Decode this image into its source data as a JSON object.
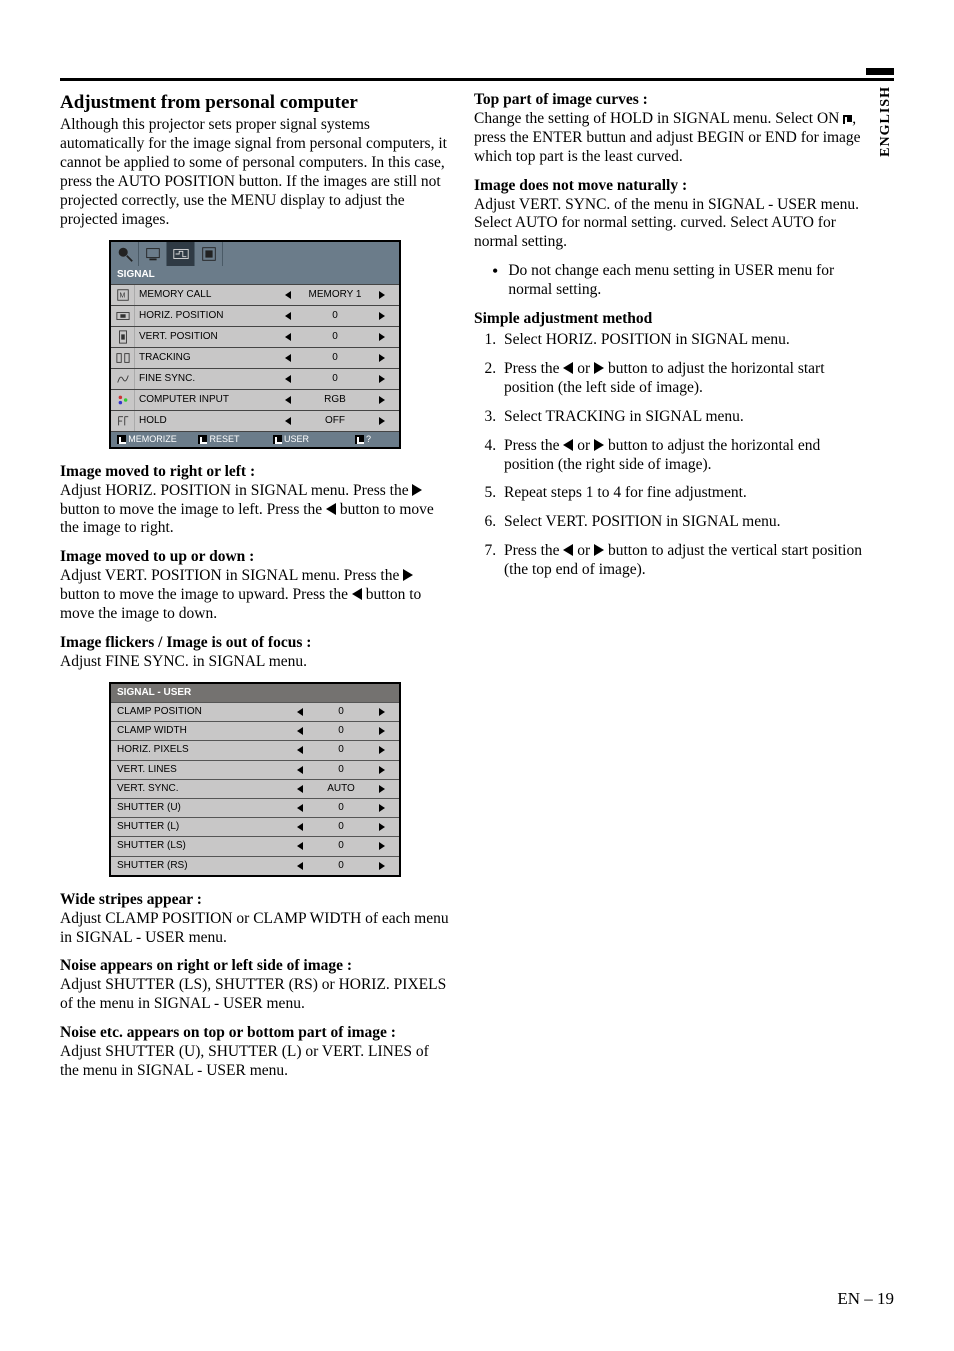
{
  "lang_label": "ENGLISH",
  "left": {
    "heading": "Adjustment from personal computer",
    "intro": "Although this projector sets proper signal systems automatically for the image signal from personal computers, it cannot be applied to some of personal computers.  In this case, press the AUTO POSITION button.  If the images are still not projected correctly, use the MENU display to adjust the projected images.",
    "signal_menu": {
      "title": "SIGNAL",
      "rows": [
        {
          "label": "MEMORY CALL",
          "value": "MEMORY 1"
        },
        {
          "label": "HORIZ. POSITION",
          "value": "0"
        },
        {
          "label": "VERT. POSITION",
          "value": "0"
        },
        {
          "label": "TRACKING",
          "value": "0"
        },
        {
          "label": "FINE SYNC.",
          "value": "0"
        },
        {
          "label": "COMPUTER INPUT",
          "value": "RGB"
        },
        {
          "label": "HOLD",
          "value": "OFF"
        }
      ],
      "footer": [
        "MEMORIZE",
        "RESET",
        "USER",
        "?"
      ]
    },
    "p1_title": "Image moved to right or left :",
    "p1_body_a": "Adjust HORIZ. POSITION in SIGNAL menu.  Press the ",
    "p1_body_b": " button to move the image to left.  Press the ",
    "p1_body_c": " button to move the image to right.",
    "p2_title": "Image moved to up or down :",
    "p2_body_a": "Adjust VERT. POSITION in SIGNAL menu.  Press the ",
    "p2_body_b": " button to move the image to upward.  Press the ",
    "p2_body_c": " button to move the image to down.",
    "p3_title": "Image flickers / Image is out of focus :",
    "p3_body": "Adjust FINE SYNC. in SIGNAL menu.",
    "user_menu": {
      "title": "SIGNAL  -  USER",
      "rows": [
        {
          "label": "CLAMP POSITION",
          "value": "0"
        },
        {
          "label": "CLAMP WIDTH",
          "value": "0"
        },
        {
          "label": "HORIZ. PIXELS",
          "value": "0"
        },
        {
          "label": "VERT. LINES",
          "value": "0"
        },
        {
          "label": "VERT. SYNC.",
          "value": "AUTO"
        },
        {
          "label": "SHUTTER (U)",
          "value": "0"
        },
        {
          "label": "SHUTTER (L)",
          "value": "0"
        },
        {
          "label": "SHUTTER (LS)",
          "value": "0"
        },
        {
          "label": "SHUTTER (RS)",
          "value": "0"
        }
      ]
    },
    "p4_title": "Wide stripes appear :",
    "p4_body": "Adjust CLAMP POSITION or CLAMP WIDTH of each menu in SIGNAL - USER menu.",
    "p5_title": "Noise appears on right or left side of image :",
    "p5_body": "Adjust SHUTTER (LS), SHUTTER (RS) or  HORIZ. PIXELS  of the menu in SIGNAL - USER menu.",
    "p6_title": "Noise etc. appears on top or bottom part of image :",
    "p6_body": "Adjust SHUTTER (U), SHUTTER (L) or VERT. LINES of the menu in SIGNAL - USER menu."
  },
  "right": {
    "p1_title": "Top part of image curves :",
    "p1_body_a": "Change the setting of HOLD in SIGNAL menu. Select ON ",
    "p1_body_b": ", press the ENTER buttun and adjust BEGIN or END for image which top part is the least curved.",
    "p2_title": "Image does not move naturally :",
    "p2_body": "Adjust VERT. SYNC. of the menu in SIGNAL - USER menu.  Select AUTO for normal setting. curved.  Select AUTO for normal setting.",
    "bullet": "Do not change each menu setting in USER menu for normal setting.",
    "p3_title": "Simple adjustment method",
    "steps": [
      "Select HORIZ. POSITION in SIGNAL menu.",
      {
        "a": "Press the ",
        "b": " or ",
        "c": " button to adjust the horizontal start position (the left side of image)."
      },
      "Select TRACKING in SIGNAL menu.",
      {
        "a": "Press the ",
        "b": " or ",
        "c": " button to adjust the horizontal end position (the right side of image)."
      },
      "Repeat steps 1 to 4 for fine adjustment.",
      "Select VERT. POSITION in SIGNAL menu.",
      {
        "a": "Press the ",
        "b": " or ",
        "c": " button to adjust the vertical start position (the top end of image)."
      }
    ]
  },
  "page_number": "EN – 19"
}
